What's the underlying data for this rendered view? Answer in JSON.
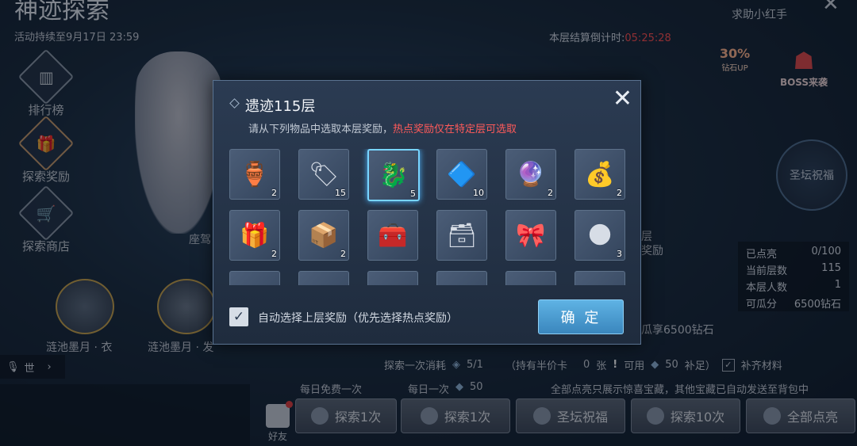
{
  "page": {
    "title": "神迹探索",
    "duration": "活动持续至9月17日 23:59",
    "help": "求助小红手",
    "countdown_label": "本层结算倒计时:",
    "countdown_value": "05:25:28",
    "countdown_color": "#ff4d4d"
  },
  "sidebar": [
    {
      "label": "排行榜",
      "icon": "podium-icon",
      "glyph": "▥"
    },
    {
      "label": "探索奖励",
      "icon": "gift-icon",
      "glyph": "🎁"
    },
    {
      "label": "探索商店",
      "icon": "shop-icon",
      "glyph": "🛒"
    }
  ],
  "badges": {
    "diamond_up": "30%",
    "diamond_up_sub": "钻石UP",
    "boss": "BOSS来袭",
    "altar": "圣坛祝福"
  },
  "background": {
    "mount_partial": "座驾",
    "layer_partial": "层",
    "reward_partial": "奖励",
    "prize_1": "涟池墨月 · 衣",
    "prize_2": "涟池墨月 · 发",
    "world_label": "世"
  },
  "stats": {
    "lit_label": "已点亮",
    "lit_value": "0/100",
    "floor_label": "当前层数",
    "floor_value": "115",
    "people_label": "本层人数",
    "people_value": "1",
    "share_label": "可瓜分",
    "share_value": "6500钻石",
    "share_line": "瓜享6500钻石"
  },
  "cost_bar": {
    "cost_label": "探索一次消耗",
    "cost_value": "5/1",
    "half_card": "（持有半价卡",
    "half_count": "0",
    "half_unit": "张",
    "usable": "可用",
    "usable_value": "50",
    "usable_suffix": "补足）",
    "fill_label": "补齐材料"
  },
  "daily": {
    "free": "每日免费一次",
    "once": "每日一次",
    "once_cost": "50"
  },
  "notice": "全部点亮只展示惊喜宝藏，其他宝藏已自动发送至背包中",
  "friends": "好友",
  "bottom_buttons": [
    {
      "label": "探索1次",
      "name": "explore-free-button"
    },
    {
      "label": "探索1次",
      "name": "explore-once-button"
    },
    {
      "label": "圣坛祝福",
      "name": "altar-blessing-button"
    },
    {
      "label": "探索10次",
      "name": "explore-ten-button"
    },
    {
      "label": "全部点亮",
      "name": "light-all-button"
    }
  ],
  "modal": {
    "title": "遗迹115层",
    "subtitle": "请从下列物品中选取本层奖励，",
    "subtitle_hot": "热点奖励仅在特定层可选取",
    "checkbox_label": "自动选择上层奖励（优先选择热点奖励）",
    "confirm": "确 定",
    "items": [
      {
        "icon": "golden-lamp-icon",
        "glyph": "🏺",
        "qty": "2"
      },
      {
        "icon": "discount-tag-icon",
        "glyph": "🏷",
        "qty": "15"
      },
      {
        "icon": "frost-dragon-icon",
        "glyph": "🐉",
        "qty": "5",
        "selected": true
      },
      {
        "icon": "crystal-shard-icon",
        "glyph": "🔷",
        "qty": "10"
      },
      {
        "icon": "star-orb-icon",
        "glyph": "🔮",
        "qty": "2"
      },
      {
        "icon": "treasure-bag-icon",
        "glyph": "💰",
        "qty": "2"
      },
      {
        "icon": "gift-chest-icon",
        "glyph": "🎁",
        "qty": "2"
      },
      {
        "icon": "golden-box-icon",
        "glyph": "📦",
        "qty": "2"
      },
      {
        "icon": "bronze-chest-icon",
        "glyph": "🧰",
        "qty": ""
      },
      {
        "icon": "silver-chest-icon",
        "glyph": "🗃",
        "qty": ""
      },
      {
        "icon": "purple-gift-icon",
        "glyph": "🎀",
        "qty": ""
      },
      {
        "icon": "dark-orb-icon",
        "glyph": "🌑",
        "qty": "3"
      },
      {
        "icon": "partial-item-icon",
        "glyph": "✦",
        "qty": ""
      },
      {
        "icon": "partial-item-icon",
        "glyph": "✦",
        "qty": ""
      },
      {
        "icon": "partial-item-icon",
        "glyph": "✦",
        "qty": ""
      },
      {
        "icon": "partial-item-icon",
        "glyph": "✦",
        "qty": ""
      },
      {
        "icon": "partial-item-icon",
        "glyph": "✦",
        "qty": ""
      },
      {
        "icon": "partial-item-icon",
        "glyph": "✦",
        "qty": ""
      }
    ]
  }
}
